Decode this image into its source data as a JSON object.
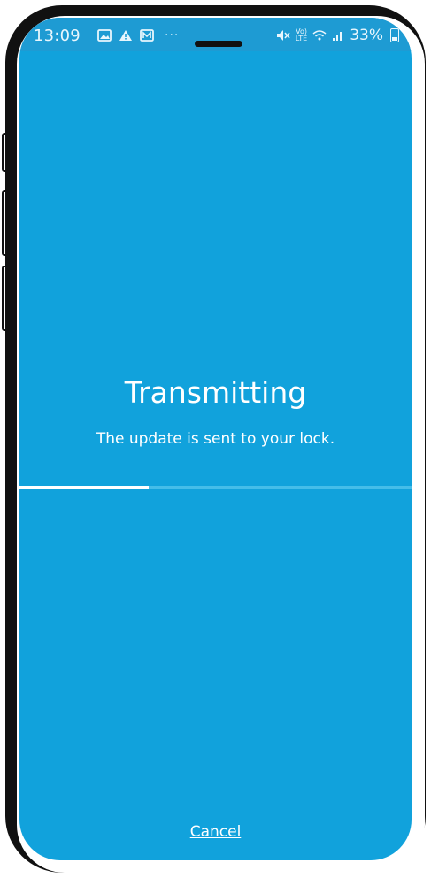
{
  "status_bar": {
    "time": "13:09",
    "left_icons": [
      "image-icon",
      "warning-icon",
      "gallery-icon"
    ],
    "more": "···",
    "network_label": "VoLTE",
    "battery": "33%"
  },
  "transmit": {
    "title": "Transmitting",
    "subtitle": "The update is sent to your lock.",
    "progress": 0.33
  },
  "actions": {
    "cancel_label": "Cancel"
  },
  "colors": {
    "screen_bg": "#11a2dc",
    "progress_track": "#45bde9",
    "progress_fill": "#ffffff"
  }
}
